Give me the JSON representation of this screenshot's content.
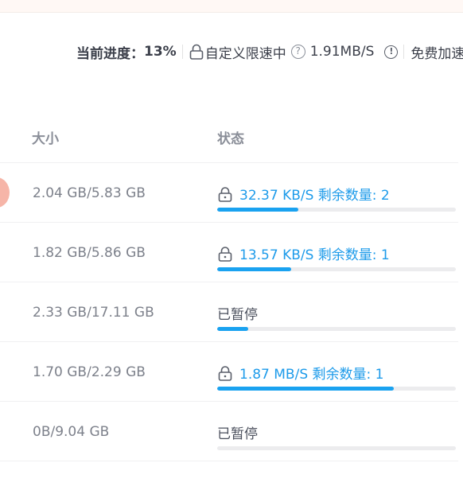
{
  "progress": {
    "label": "当前进度：",
    "value": "13%",
    "speed_mode": "自定义限速中",
    "speed": "1.91MB/S",
    "free_speedup": "免费加速"
  },
  "columns": {
    "size": "大小",
    "status": "状态"
  },
  "rows": [
    {
      "size": "2.04 GB/5.83 GB",
      "status_text": "32.37 KB/S 剩余数量: 2",
      "locked": true,
      "progress": 0.34,
      "state": "active"
    },
    {
      "size": "1.82 GB/5.86 GB",
      "status_text": "13.57 KB/S 剩余数量: 1",
      "locked": true,
      "progress": 0.31,
      "state": "active"
    },
    {
      "size": "2.33 GB/17.11 GB",
      "status_text": "已暂停",
      "locked": false,
      "progress": 0.13,
      "state": "paused"
    },
    {
      "size": "1.70 GB/2.29 GB",
      "status_text": "1.87 MB/S 剩余数量: 1",
      "locked": true,
      "progress": 0.74,
      "state": "active"
    },
    {
      "size": "0B/9.04 GB",
      "status_text": "已暂停",
      "locked": false,
      "progress": 0.0,
      "state": "paused"
    }
  ],
  "colors": {
    "accent": "#1aa2f0",
    "track": "#ececee"
  }
}
